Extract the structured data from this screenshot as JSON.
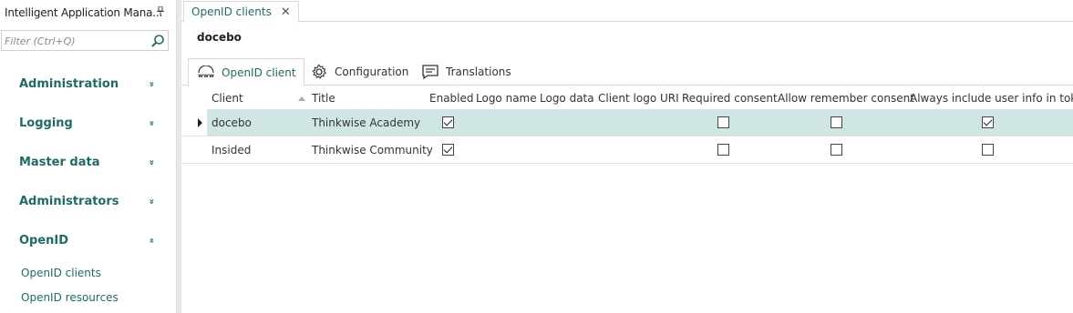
{
  "sidebar": {
    "app_title": "Intelligent Application Mana...",
    "pin_icon": "pin-icon",
    "filter_placeholder": "Filter (Ctrl+Q)",
    "filter_icon": "search-icon",
    "groups": [
      {
        "label": "Administration",
        "chevron": "»",
        "expanded": false
      },
      {
        "label": "Logging",
        "chevron": "»",
        "expanded": false
      },
      {
        "label": "Master data",
        "chevron": "»",
        "expanded": false
      },
      {
        "label": "Administrators",
        "chevron": "»",
        "expanded": false
      },
      {
        "label": "OpenID",
        "chevron": "«",
        "expanded": true
      }
    ],
    "items": [
      {
        "label": "OpenID clients"
      },
      {
        "label": "OpenID resources"
      }
    ]
  },
  "document_tab": {
    "label": "OpenID clients",
    "close": "✕"
  },
  "record_title": "docebo",
  "detail_tabs": [
    {
      "label": "OpenID client",
      "icon": "www-icon",
      "active": true
    },
    {
      "label": "Configuration",
      "icon": "gear-icon",
      "active": false
    },
    {
      "label": "Translations",
      "icon": "comment-icon",
      "active": false
    }
  ],
  "grid": {
    "columns": [
      "Client",
      "Title",
      "Enabled",
      "Logo name",
      "Logo data",
      "Client logo URI",
      "Required consent",
      "Allow remember consent",
      "Always include user info in token"
    ],
    "rows": [
      {
        "client": "docebo",
        "title": "Thinkwise Academy",
        "enabled": true,
        "logo_name": "",
        "logo_data": "",
        "client_logo_uri": "",
        "required_consent": false,
        "allow_remember_consent": false,
        "always_include_user_info": true,
        "selected": true
      },
      {
        "client": "Insided",
        "title": "Thinkwise Community",
        "enabled": true,
        "logo_name": "",
        "logo_data": "",
        "client_logo_uri": "",
        "required_consent": false,
        "allow_remember_consent": false,
        "always_include_user_info": false,
        "selected": false
      }
    ]
  },
  "colors": {
    "accent": "#1e6b63",
    "selected_row": "#cfe6e4"
  }
}
